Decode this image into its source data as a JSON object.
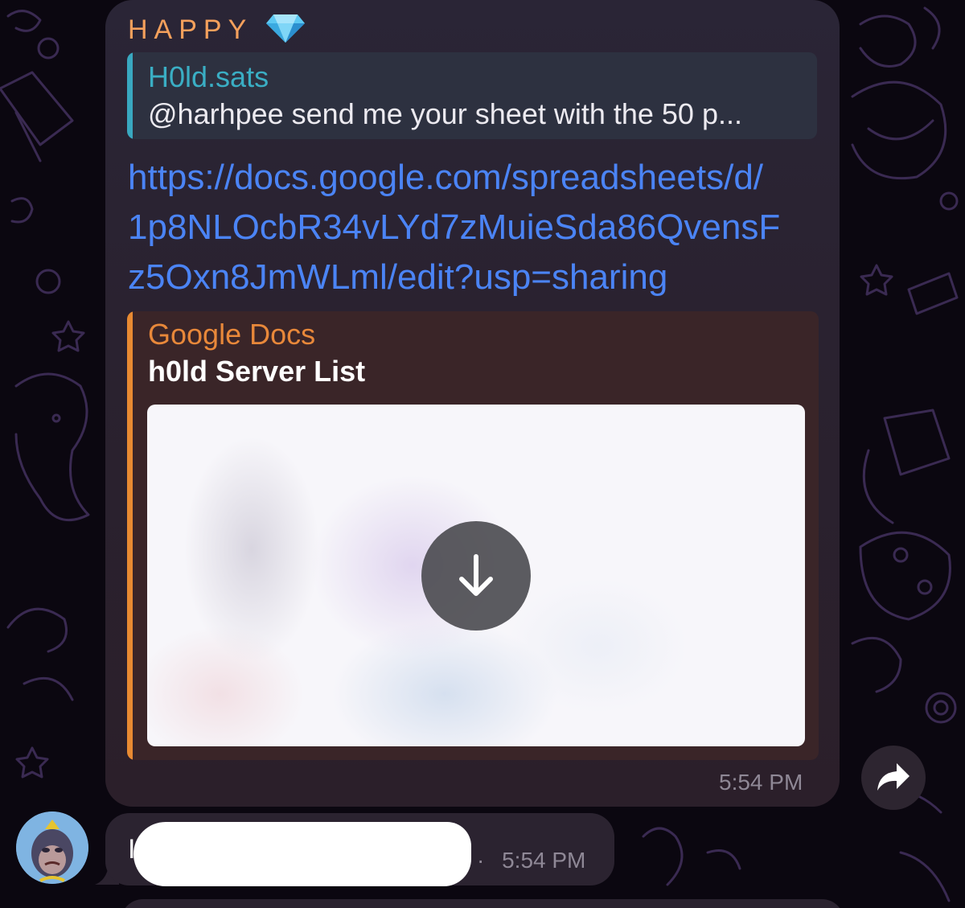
{
  "message": {
    "sender": "HAPPY",
    "sender_badge_icon": "gem-icon",
    "reply": {
      "author": "H0ld.sats",
      "text": "@harhpee send me your sheet with the 50 p..."
    },
    "link_lines": [
      "https://docs.google.com/spreadsheets/d/",
      "1p8NLOcbR34vLYd7zMuieSda86QvensF",
      "z5Oxn8JmWLml/edit?usp=sharing"
    ],
    "link_preview": {
      "site_name": "Google Docs",
      "title": "h0ld Server List",
      "action_icon": "download-icon"
    },
    "time": "5:54 PM"
  },
  "share_icon": "share-arrow-icon",
  "next_message": {
    "text_prefix": "I",
    "trailing_dot": "·",
    "time": "5:54 PM",
    "avatar_icon": "ape-avatar"
  },
  "colors": {
    "sender": "#f4a05c",
    "reply_accent": "#39a8c0",
    "link": "#4b84f5",
    "preview_accent": "#e88a32",
    "background": "#0b0710"
  }
}
